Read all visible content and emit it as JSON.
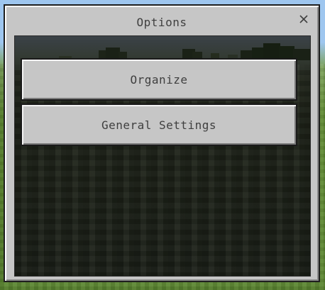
{
  "dialog": {
    "title": "Options",
    "close_icon": "close-icon"
  },
  "menu": {
    "items": [
      {
        "label": "Organize"
      },
      {
        "label": "General Settings"
      }
    ]
  },
  "colors": {
    "panel": "#c6c6c6",
    "button": "#c6c6c6",
    "text": "#3f3f3f",
    "content_bg": "#1f241a"
  }
}
